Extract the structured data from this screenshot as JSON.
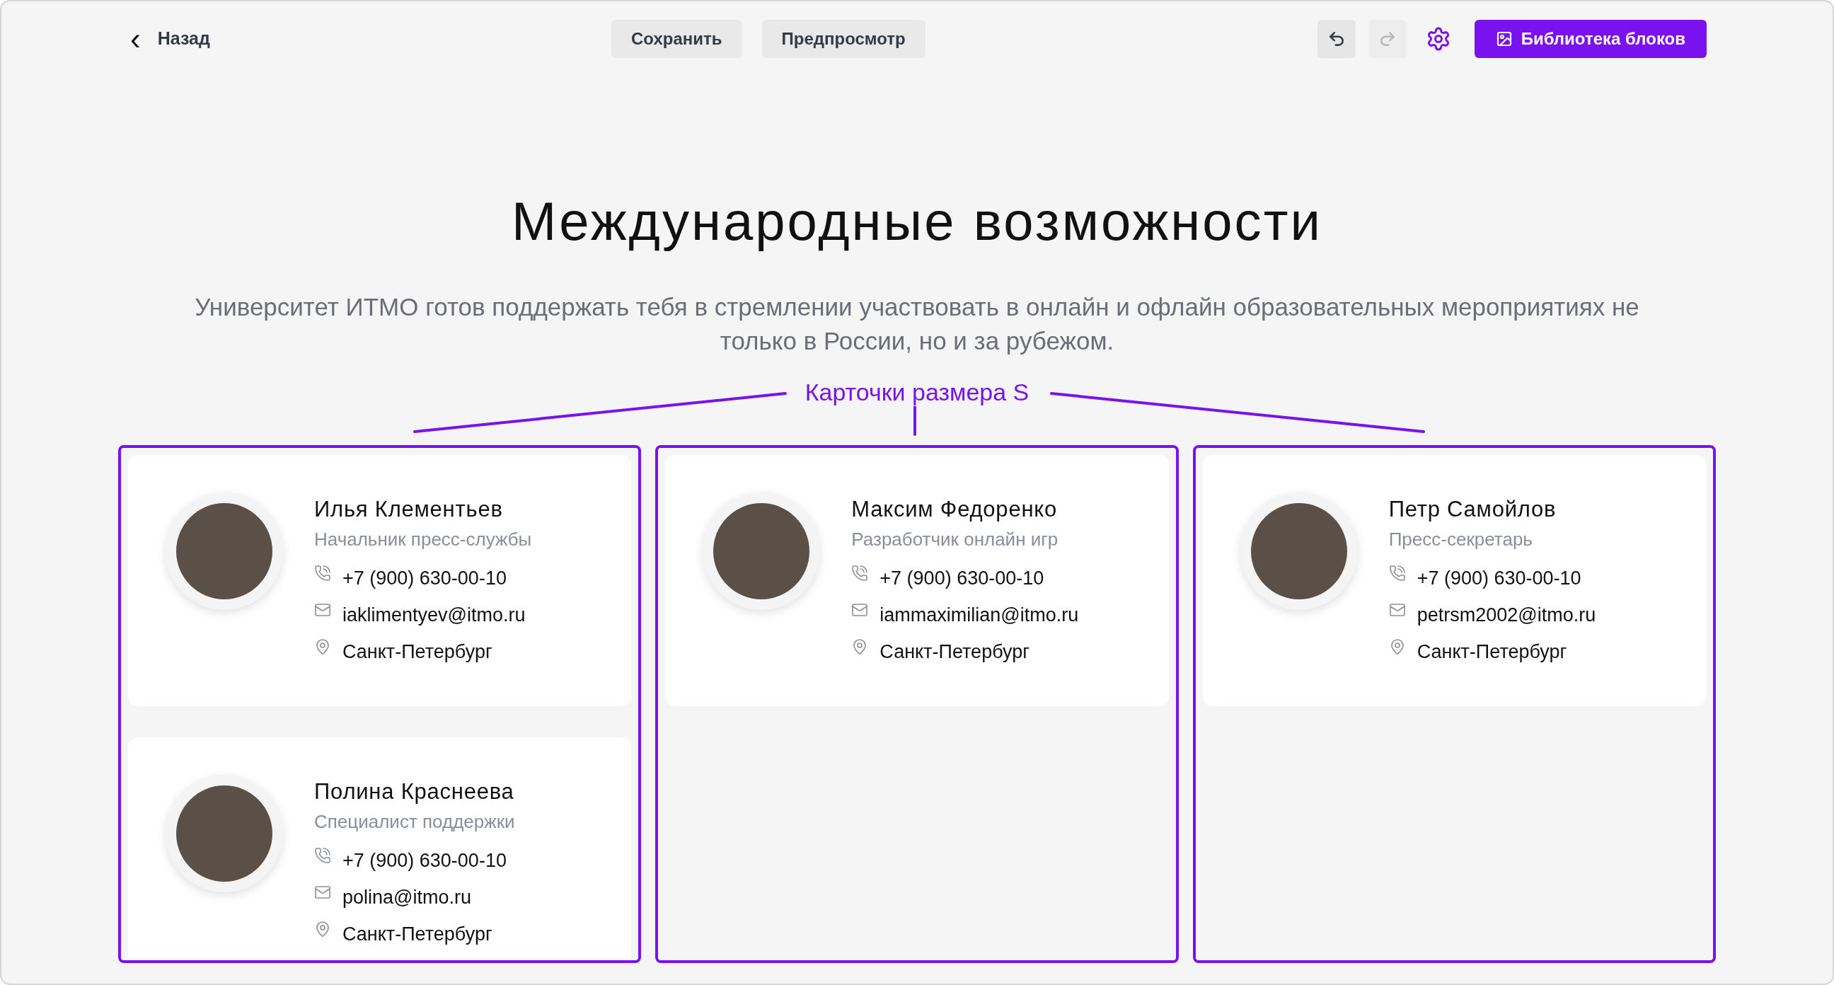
{
  "toolbar": {
    "back": {
      "icon": "‹",
      "label": "Назад"
    },
    "buttons": [
      {
        "label": "Сохранить"
      },
      {
        "label": "Предпросмотр"
      }
    ],
    "history": [
      {
        "kind": "undo",
        "disabled": false
      },
      {
        "kind": "redo",
        "disabled": true
      }
    ],
    "library_button": {
      "label": "Библиотека блоков"
    }
  },
  "title": "Международные возможности",
  "subtitle": "Университет ИТМО готов поддержать тебя в стремлении участвовать в онлайн и офлайн образовательных мероприятиях не только в России, но и за рубежом.",
  "annotation": {
    "label": "Карточки размера S"
  },
  "columns": [
    {
      "cards": [
        {
          "name": "Илья Клементьев",
          "role": "Начальник пресс-службы",
          "contacts": [
            {
              "kind": "phone",
              "text": "+7 (900) 630-00-10"
            },
            {
              "kind": "email",
              "text": "iaklimentyev@itmo.ru"
            },
            {
              "kind": "location",
              "text": "Санкт-Петербург"
            }
          ]
        },
        {
          "name": "Полина Краснеева",
          "role": "Специалист поддержки",
          "contacts": [
            {
              "kind": "phone",
              "text": "+7 (900) 630-00-10"
            },
            {
              "kind": "email",
              "text": "polina@itmo.ru"
            },
            {
              "kind": "location",
              "text": "Санкт-Петербург"
            }
          ]
        }
      ]
    },
    {
      "cards": [
        {
          "name": "Максим Федоренко",
          "role": "Разработчик онлайн игр",
          "contacts": [
            {
              "kind": "phone",
              "text": "+7 (900) 630-00-10"
            },
            {
              "kind": "email",
              "text": "iammaximilian@itmo.ru"
            },
            {
              "kind": "location",
              "text": "Санкт-Петербург"
            }
          ]
        }
      ]
    },
    {
      "cards": [
        {
          "name": "Петр Самойлов",
          "role": "Пресс-секретарь",
          "contacts": [
            {
              "kind": "phone",
              "text": "+7 (900) 630-00-10"
            },
            {
              "kind": "email",
              "text": "petrsm2002@itmo.ru"
            },
            {
              "kind": "location",
              "text": "Санкт-Петербург"
            }
          ]
        }
      ]
    }
  ]
}
